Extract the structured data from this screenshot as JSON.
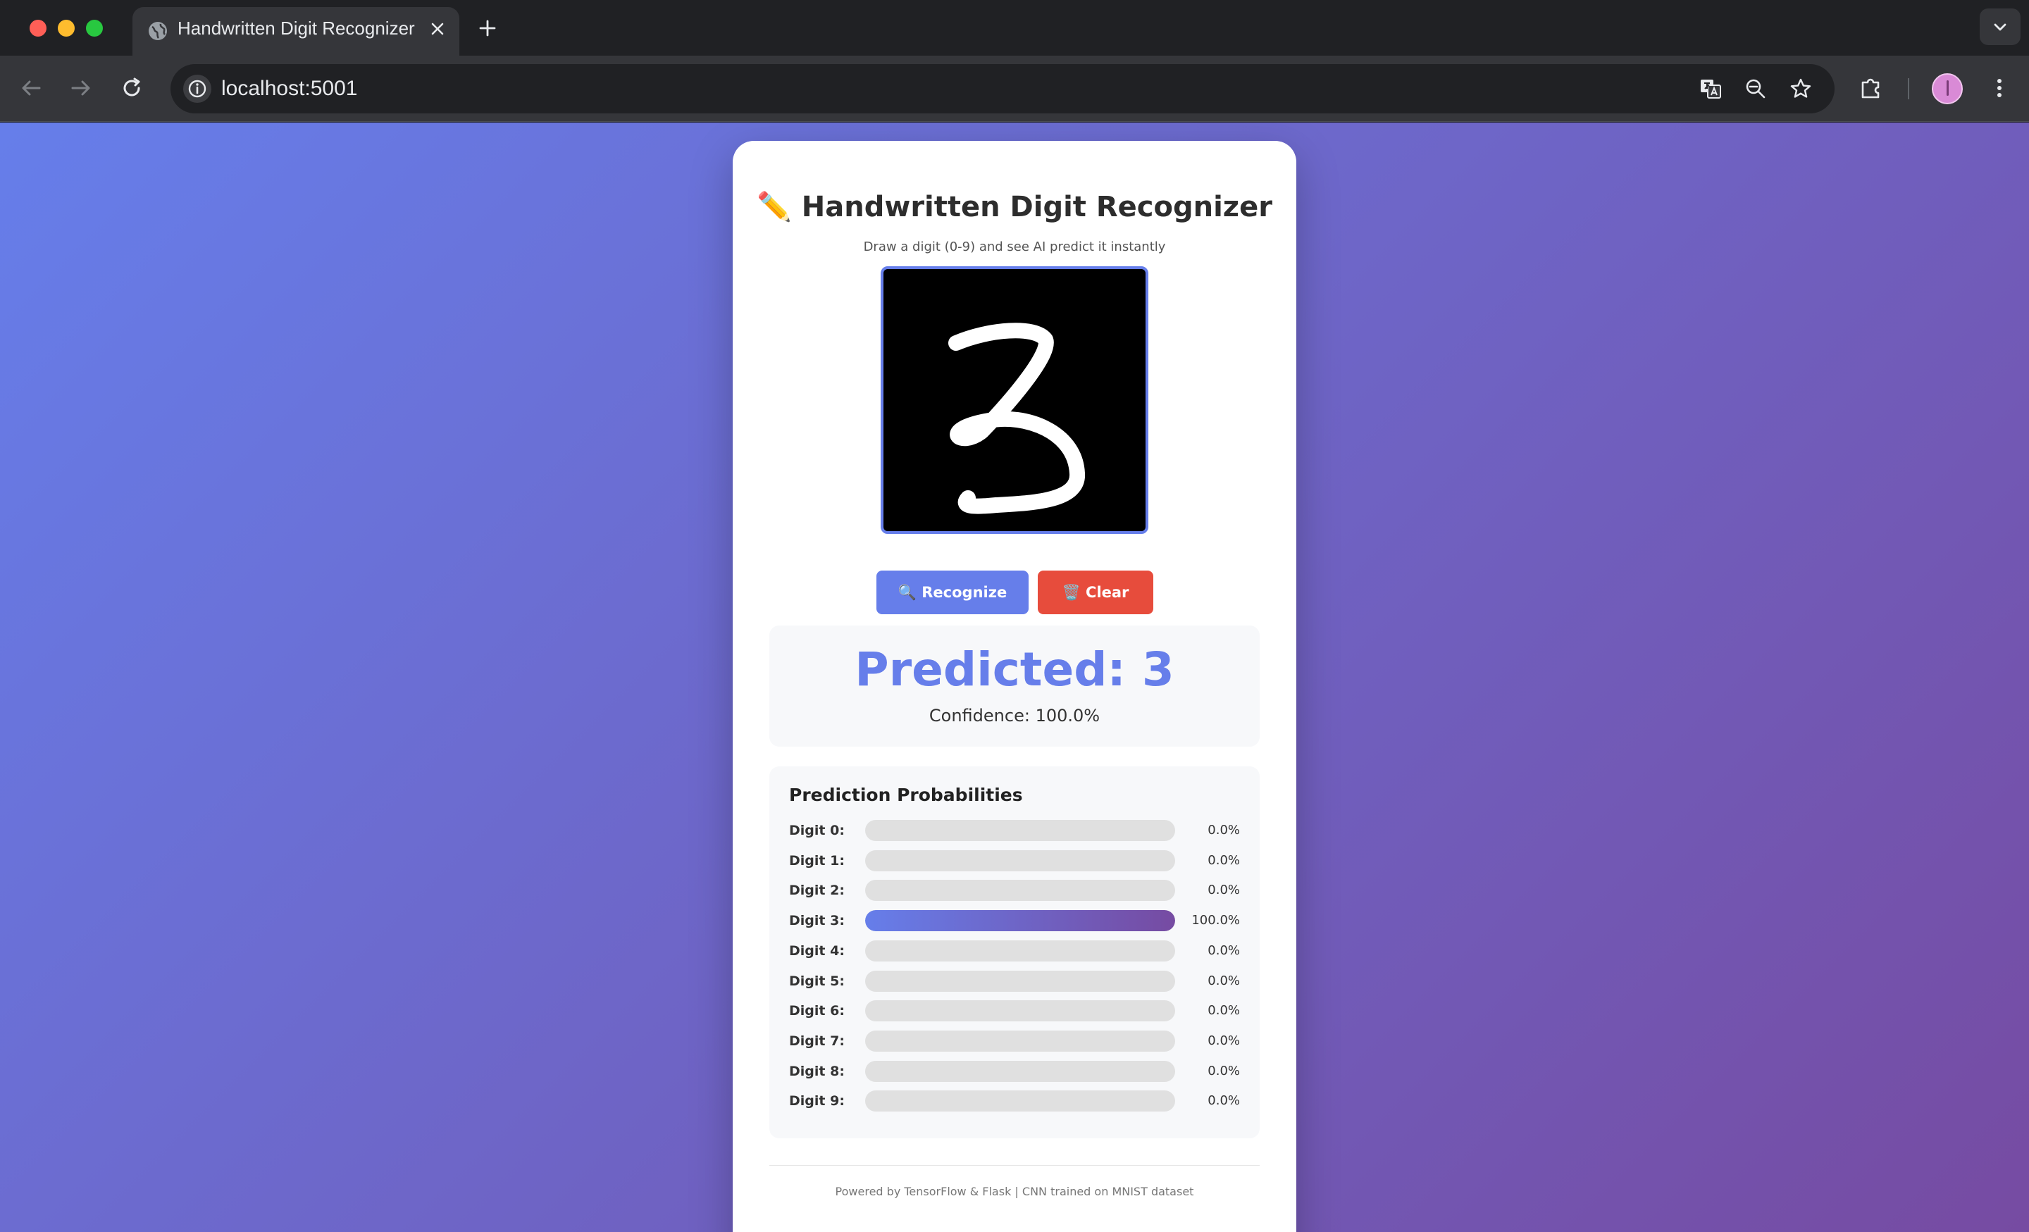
{
  "browser": {
    "tab_title": "Handwritten Digit Recognizer",
    "url": "localhost:5001"
  },
  "app": {
    "title": "✏️ Handwritten Digit Recognizer",
    "subtitle": "Draw a digit (0-9) and see AI predict it instantly",
    "recognize_label": "🔍 Recognize",
    "clear_label": "🗑️ Clear",
    "predicted_text": "Predicted: 3",
    "confidence_text": "Confidence: 100.0%",
    "probabilities_title": "Prediction Probabilities",
    "probabilities": [
      {
        "label": "Digit 0:",
        "value": "0.0%",
        "fraction": 0
      },
      {
        "label": "Digit 1:",
        "value": "0.0%",
        "fraction": 0
      },
      {
        "label": "Digit 2:",
        "value": "0.0%",
        "fraction": 0
      },
      {
        "label": "Digit 3:",
        "value": "100.0%",
        "fraction": 1
      },
      {
        "label": "Digit 4:",
        "value": "0.0%",
        "fraction": 0
      },
      {
        "label": "Digit 5:",
        "value": "0.0%",
        "fraction": 0
      },
      {
        "label": "Digit 6:",
        "value": "0.0%",
        "fraction": 0
      },
      {
        "label": "Digit 7:",
        "value": "0.0%",
        "fraction": 0
      },
      {
        "label": "Digit 8:",
        "value": "0.0%",
        "fraction": 0
      },
      {
        "label": "Digit 9:",
        "value": "0.0%",
        "fraction": 0
      }
    ],
    "footer": "Powered by TensorFlow & Flask | CNN trained on MNIST dataset"
  },
  "colors": {
    "accent": "#667eea",
    "gradient_end": "#764ba2",
    "clear_button": "#e74c3c"
  },
  "icons": [
    "globe-icon",
    "close-icon",
    "plus-icon",
    "chevron-down-icon",
    "back-arrow-icon",
    "forward-arrow-icon",
    "reload-icon",
    "info-icon",
    "translate-icon",
    "zoom-icon",
    "star-icon",
    "extensions-icon",
    "menu-dots-icon"
  ]
}
